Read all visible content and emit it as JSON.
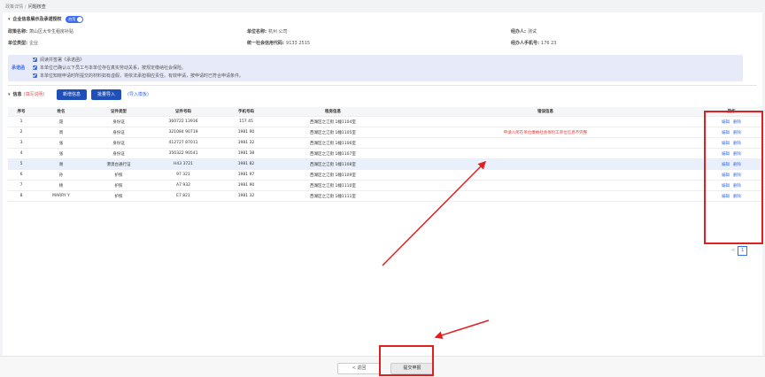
{
  "breadcrumb": {
    "parent": "政策详情",
    "current": "问题核查"
  },
  "section1": {
    "title": "企业信息展示及承诺授权",
    "toggle_label": "启用"
  },
  "company": {
    "policy_label": "政策名称:",
    "policy_value": "萧山区大专生租房补贴",
    "unit_name_label": "单位名称:",
    "unit_name_value": "杭州                  公司",
    "handler_label": "经办人:",
    "handler_value": "测试",
    "unit_type_label": "单位类型:",
    "unit_type_value": "企业",
    "credit_label": "统一社会信用代码:",
    "credit_value": "9133                  2515",
    "handler_phone_label": "经办人手机号:",
    "handler_phone_value": "176         23"
  },
  "commitment": {
    "title": "承诺函",
    "items": [
      "阅读并签署《承诺函》",
      "本单位已确认以下员工与本单位存在真实劳动关系，按规定缴纳社会保险。",
      "本单位知晓申请时所提交的材料如有虚假，将依法承担相应责任。有效申请，按申请时已符合申请条件。"
    ]
  },
  "toolbar": {
    "title": "信息",
    "note": "(填写说明)",
    "add_label": "新增信息",
    "batch_label": "批量导入",
    "import_link": "(导入模板)"
  },
  "table": {
    "headers": [
      "序号",
      "姓名",
      "证件类型",
      "证件号码",
      "手机号码",
      "租房信息",
      "错误信息",
      "操作"
    ],
    "rows": [
      {
        "no": "1",
        "name": "聂",
        "id_type": "身份证",
        "id_no": "360722          13936",
        "phone": "157          45",
        "rent": "西湖区之江街           1幢1104室",
        "error": ""
      },
      {
        "no": "2",
        "name": "周",
        "id_type": "身份证",
        "id_no": "321084          90719",
        "phone": "1981          90",
        "rent": "西湖区之江街           1幢1105室",
        "error": "申请人所在单位缴纳社会保险工单位信息不完整"
      },
      {
        "no": "3",
        "name": "张",
        "id_type": "身份证",
        "id_no": "412727          87011",
        "phone": "1981          32",
        "rent": "西湖区之江街           1幢1106室",
        "error": ""
      },
      {
        "no": "4",
        "name": "张",
        "id_type": "身份证",
        "id_no": "350322          90541",
        "phone": "1981          38",
        "rent": "西湖区之江街           1幢1107室",
        "error": ""
      },
      {
        "no": "5",
        "name": "谢",
        "id_type": "港澳台通行证",
        "id_no": "H43          3721",
        "phone": "1981          82",
        "rent": "西湖区之江街           1幢1108室",
        "error": ""
      },
      {
        "no": "6",
        "name": "孙",
        "id_type": "护照",
        "id_no": "97          321",
        "phone": "1981          97",
        "rent": "西湖区之江街           1幢1109室",
        "error": ""
      },
      {
        "no": "7",
        "name": "杨",
        "id_type": "护照",
        "id_no": "A7          932",
        "phone": "1981          90",
        "rent": "西湖区之江街           1幢1110室",
        "error": ""
      },
      {
        "no": "8",
        "name": "MARRY          Y",
        "id_type": "护照",
        "id_no": "E7          821",
        "phone": "1981          32",
        "rent": "西湖区之江街           1幢1111室",
        "error": ""
      }
    ],
    "edit_label": "编辑",
    "delete_label": "删除"
  },
  "pager": {
    "prev": "<",
    "page": "1"
  },
  "footer": {
    "back_label": "< 返回",
    "submit_label": "提交申报"
  },
  "colors": {
    "accent": "#3a6ff0",
    "highlight": "#e02020",
    "primary_button": "#1f4fb8"
  }
}
